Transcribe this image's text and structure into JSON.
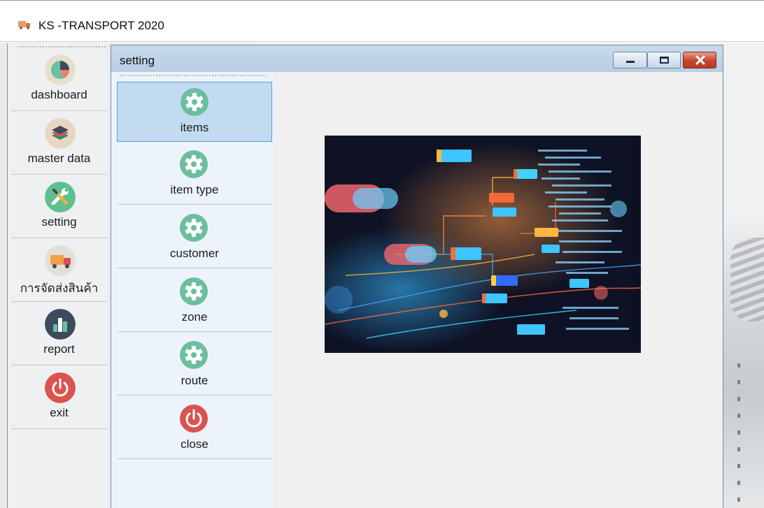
{
  "app": {
    "title": "KS -TRANSPORT 2020",
    "icon": "truck-icon"
  },
  "main_nav": {
    "items": [
      {
        "label": "dashboard",
        "icon": "pie-chart-icon",
        "color": "#6bbfa0"
      },
      {
        "label": "master data",
        "icon": "layers-icon",
        "color": "#e7d7c2"
      },
      {
        "label": "setting",
        "icon": "wrench-screwdriver-icon",
        "color": "#5fbf8e"
      },
      {
        "label": "การจัดส่งสินค้า",
        "icon": "truck-icon",
        "color": "#e2e0d8"
      },
      {
        "label": "report",
        "icon": "bar-chart-icon",
        "color": "#3d4a5c"
      },
      {
        "label": "exit",
        "icon": "power-icon",
        "color": "#d9534f"
      }
    ]
  },
  "setting_window": {
    "title": "setting",
    "controls": {
      "minimize": "minimize-icon",
      "maximize": "maximize-icon",
      "close": "close-icon"
    },
    "items": [
      {
        "label": "items",
        "icon": "gear-icon",
        "color": "#6bbf9e",
        "active": true
      },
      {
        "label": "item type",
        "icon": "gear-icon",
        "color": "#6bbf9e",
        "active": false
      },
      {
        "label": "customer",
        "icon": "gear-icon",
        "color": "#6bbf9e",
        "active": false
      },
      {
        "label": "zone",
        "icon": "gear-icon",
        "color": "#6bbf9e",
        "active": false
      },
      {
        "label": "route",
        "icon": "gear-icon",
        "color": "#6bbf9e",
        "active": false
      },
      {
        "label": "close",
        "icon": "power-icon",
        "color": "#d9534f",
        "active": false
      }
    ]
  },
  "colors": {
    "active_item_bg": "#c3dbf0",
    "active_item_border": "#5b9ad4",
    "window_titlebar": "#c0d5ea",
    "close_button": "#c8452e"
  }
}
